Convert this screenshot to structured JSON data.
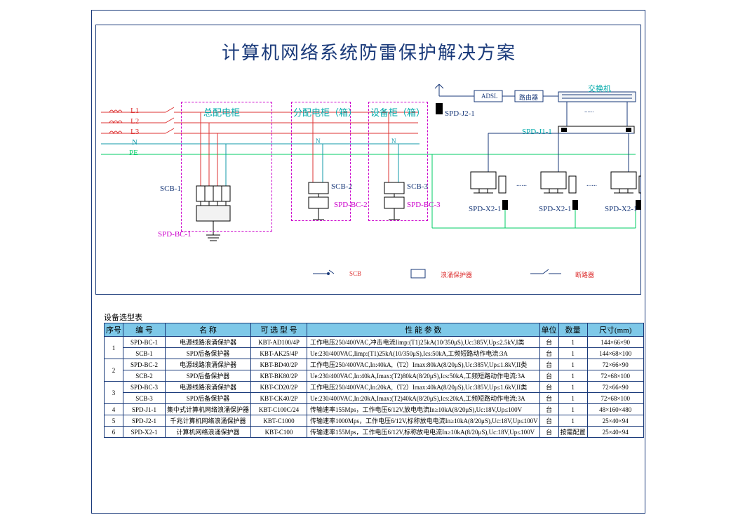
{
  "title": "计算机网络系统防雷保护解决方案",
  "power": {
    "lines": [
      "L1",
      "L2",
      "L3",
      "N",
      "PE"
    ],
    "main_cabinet": "总配电柜",
    "sub_cabinet": "分配电柜（箱）",
    "equip_cabinet": "设备柜（箱）",
    "scb": [
      "SCB-1",
      "SCB-2",
      "SCB-3"
    ],
    "spd_bc": [
      "SPD-BC-1",
      "SPD-BC-2",
      "SPD-BC-3"
    ]
  },
  "network": {
    "dev": [
      "ADSL",
      "路由器",
      "交换机"
    ],
    "spd_j2": "SPD-J2-1",
    "spd_j1": "SPD-J1-1",
    "spd_x2": "SPD-X2-1",
    "port_dots": "......"
  },
  "legend": {
    "scb": "SCB",
    "spd": "浪涌保护器",
    "breaker": "断路器"
  },
  "table_caption": "设备选型表",
  "headers": [
    "序号",
    "编 号",
    "名 称",
    "可 选 型 号",
    "性 能 参 数",
    "单位",
    "数量",
    "尺寸(mm)"
  ],
  "rows": [
    {
      "n": "1",
      "c": "SPD-BC-1",
      "name": "电源线路浪涌保护器",
      "model": "KBT-AD100/4P",
      "spec": "工作电压250/400VAC,冲击电流Iimp:(T1)25kA(10/350μS),Uc:385V,Up≤2.5kV,I类",
      "u": "台",
      "q": "1",
      "d": "144×66×90"
    },
    {
      "n": "",
      "c": "SCB-1",
      "name": "SPD后备保护器",
      "model": "KBT-AK25/4P",
      "spec": "Ue:230/400VAC,Iimp:(T1)25kA(10/350μS),Ics:50kA,工频短路动作电流:3A",
      "u": "台",
      "q": "1",
      "d": "144×68×100"
    },
    {
      "n": "2",
      "c": "SPD-BC-2",
      "name": "电源线路浪涌保护器",
      "model": "KBT-BD40/2P",
      "spec": "工作电压250/400VAC,In:40kA,（T2）Imax:80kA(8/20μS),Uc:385V,Up≤1.8kV,II类",
      "u": "台",
      "q": "1",
      "d": "72×66×90"
    },
    {
      "n": "",
      "c": "SCB-2",
      "name": "SPD后备保护器",
      "model": "KBT-BK80/2P",
      "spec": "Ue:230/400VAC,In:40kA,Imax:(T2)80kA(8/20μS),Ics:50kA,工频短路动作电流:3A",
      "u": "台",
      "q": "1",
      "d": "72×68×100"
    },
    {
      "n": "3",
      "c": "SPD-BC-3",
      "name": "电源线路浪涌保护器",
      "model": "KBT-CD20/2P",
      "spec": "工作电压250/400VAC,In:20kA,（T2）Imax:40kA(8/20μS),Uc:385V,Up≤1.6kV,II类",
      "u": "台",
      "q": "1",
      "d": "72×66×90"
    },
    {
      "n": "",
      "c": "SCB-3",
      "name": "SPD后备保护器",
      "model": "KBT-CK40/2P",
      "spec": "Ue:230/400VAC,In:20kA,Imax:(T2)40kA(8/20μS),Ics:20kA,工频短路动作电流:3A",
      "u": "台",
      "q": "1",
      "d": "72×68×100"
    },
    {
      "n": "4",
      "c": "SPD-J1-1",
      "name": "集中式计算机网络浪涌保护器",
      "model": "KBT-C100C/24",
      "spec": "传输速率155Mps，工作电压6/12V,放电电流In≥10kA(8/20μS),Uc:18V,Up≤100V",
      "u": "台",
      "q": "1",
      "d": "48×160×480"
    },
    {
      "n": "5",
      "c": "SPD-J2-1",
      "name": "千兆计算机网络浪涌保护器",
      "model": "KBT-C1000",
      "spec": "传输速率1000Mps，工作电压6/12V,标称放电电流In≥10kA(8/20μS),Uc:18V,Up≤100V",
      "u": "台",
      "q": "1",
      "d": "25×40×94"
    },
    {
      "n": "6",
      "c": "SPD-X2-1",
      "name": "计算机网络浪涌保护器",
      "model": "KBT-C100",
      "spec": "传输速率155Mps，工作电压6/12V,标称放电电流In≥10kA(8/20μS),Uc:18V,Up≤100V",
      "u": "台",
      "q": "按需配置",
      "d": "25×40×94"
    }
  ]
}
